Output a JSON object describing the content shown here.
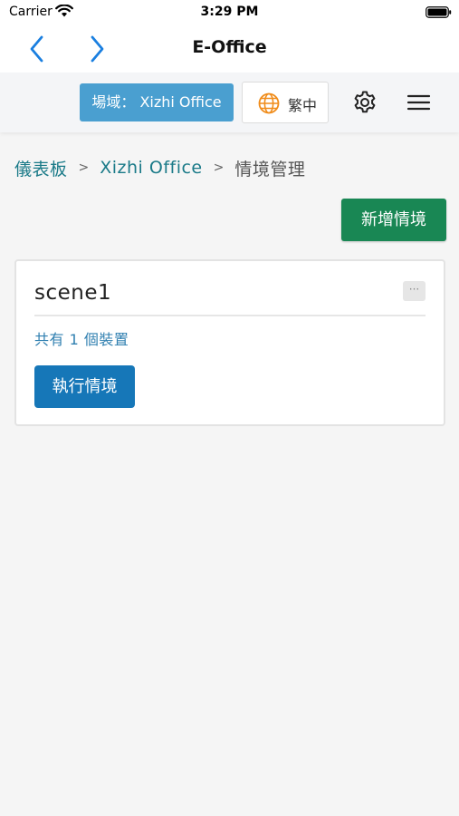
{
  "status_bar": {
    "carrier": "Carrier",
    "time": "3:29 PM"
  },
  "nav_bar": {
    "title": "E-Office"
  },
  "header": {
    "site_label": "場域： Xizhi Office",
    "language_label": "繁中"
  },
  "breadcrumb": {
    "items": [
      "儀表板",
      "Xizhi Office",
      "情境管理"
    ],
    "separator": ">"
  },
  "actions": {
    "add_scene_label": "新增情境"
  },
  "scene_card": {
    "name": "scene1",
    "more_label": "···",
    "device_count_text": "共有 1 個裝置",
    "run_label": "執行情境"
  },
  "colors": {
    "site_button": "#4a9fd0",
    "add_button": "#198754",
    "run_button": "#1677b8",
    "link": "#1a7a88",
    "nav_arrow": "#1a7fe0",
    "globe": "#f08c1a"
  }
}
